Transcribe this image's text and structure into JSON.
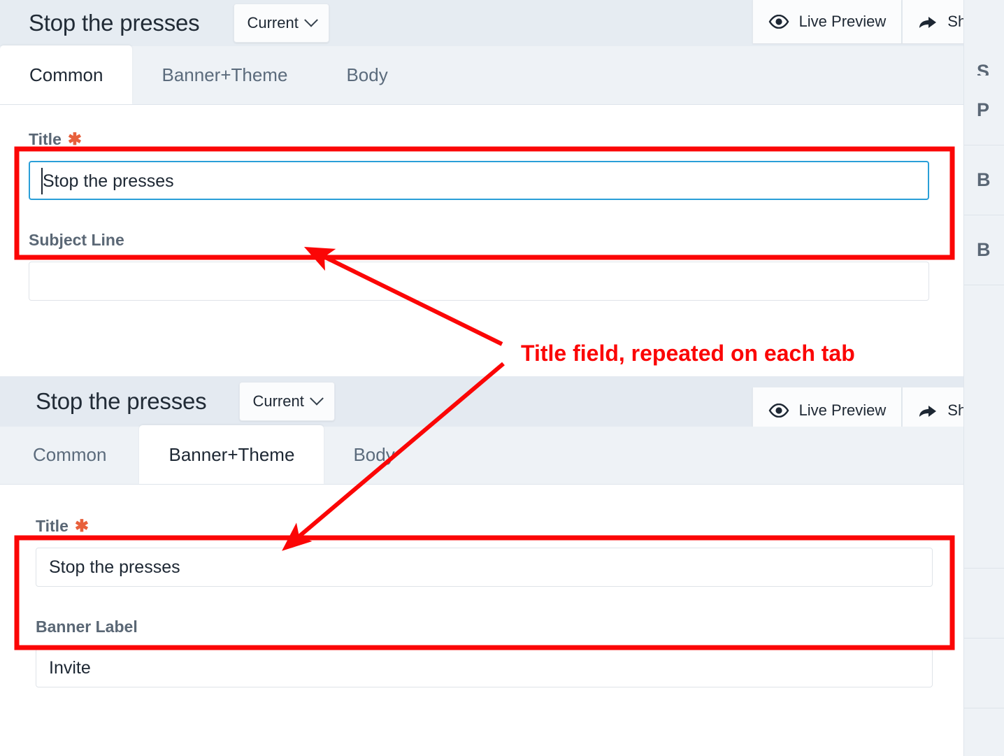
{
  "panels": [
    {
      "id": "panel-common",
      "header": {
        "doc_title": "Stop the presses",
        "version_label": "Current",
        "live_preview_label": "Live Preview",
        "share_label": "Share"
      },
      "tabs": [
        {
          "label": "Common",
          "active": true
        },
        {
          "label": "Banner+Theme",
          "active": false
        },
        {
          "label": "Body",
          "active": false
        }
      ],
      "fields": [
        {
          "label": "Title",
          "required": true,
          "value": "Stop the presses",
          "focused": true
        },
        {
          "label": "Subject Line",
          "required": false,
          "value": "",
          "focused": false
        }
      ],
      "right_rail": [
        "S",
        "P",
        "B",
        "B"
      ]
    },
    {
      "id": "panel-banner-theme",
      "header": {
        "doc_title": "Stop the presses",
        "version_label": "Current",
        "live_preview_label": "Live Preview",
        "share_label": "Share"
      },
      "tabs": [
        {
          "label": "Common",
          "active": false
        },
        {
          "label": "Banner+Theme",
          "active": true
        },
        {
          "label": "Body",
          "active": false
        }
      ],
      "fields": [
        {
          "label": "Title",
          "required": true,
          "value": "Stop the presses",
          "focused": false
        },
        {
          "label": "Banner Label",
          "required": false,
          "value": "Invite",
          "focused": false
        }
      ],
      "right_rail": [
        "",
        "",
        "",
        ""
      ]
    }
  ],
  "annotation": {
    "text": "Title field, repeated on each tab",
    "color": "#fb0606"
  },
  "icons": {
    "eye": "eye-icon",
    "share": "share-icon",
    "chevron": "chevron-down-icon"
  }
}
